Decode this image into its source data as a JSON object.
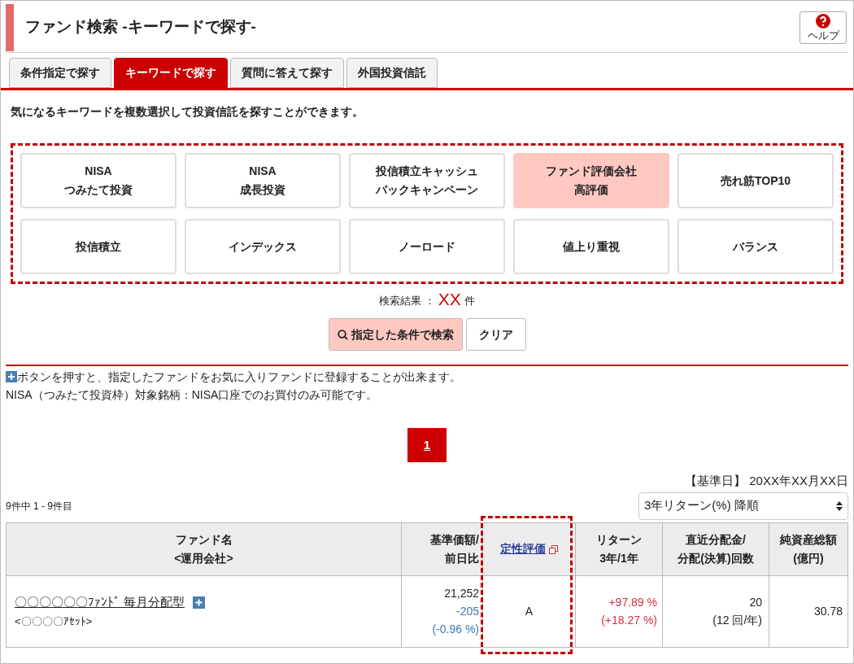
{
  "header": {
    "title": "ファンド検索 -キーワードで探す-",
    "help_label": "ヘルプ"
  },
  "tabs": [
    {
      "label": "条件指定で探す",
      "selected": false
    },
    {
      "label": "キーワードで探す",
      "selected": true
    },
    {
      "label": "質問に答えて探す",
      "selected": false
    },
    {
      "label": "外国投資信託",
      "selected": false
    }
  ],
  "description": "気になるキーワードを複数選択して投資信託を探すことができます。",
  "keywords": [
    {
      "lines": [
        "NISA",
        "つみたて投資"
      ],
      "selected": false
    },
    {
      "lines": [
        "NISA",
        "成長投資"
      ],
      "selected": false
    },
    {
      "lines": [
        "投信積立キャッシュ",
        "バックキャンペーン"
      ],
      "selected": false
    },
    {
      "lines": [
        "ファンド評価会社",
        "高評価"
      ],
      "selected": true
    },
    {
      "lines": [
        "売れ筋TOP10"
      ],
      "selected": false
    },
    {
      "lines": [
        "投信積立"
      ],
      "selected": false
    },
    {
      "lines": [
        "インデックス"
      ],
      "selected": false
    },
    {
      "lines": [
        "ノーロード"
      ],
      "selected": false
    },
    {
      "lines": [
        "値上り重視"
      ],
      "selected": false
    },
    {
      "lines": [
        "バランス"
      ],
      "selected": false
    }
  ],
  "result": {
    "label": "検索結果 ：",
    "count": "XX",
    "unit": "件"
  },
  "search_button": "指定した条件で検索",
  "clear_button": "クリア",
  "notes": [
    "ボタンを押すと、指定したファンドをお気に入りファンドに登録することが出来ます。",
    "NISA（つみたて投資枠）対象銘柄：NISA口座でのお買付のみ可能です。"
  ],
  "pages": [
    {
      "label": "1",
      "selected": true
    }
  ],
  "base_date": "【基準日】 20XX年XX月XX日",
  "range": "9件中 1 - 9件目",
  "sort": {
    "value": "3年リターン(%) 降順"
  },
  "table": {
    "columns": [
      {
        "lines": [
          "ファンド名",
          "<運用会社>"
        ]
      },
      {
        "lines": [
          "基準価額/",
          "前日比"
        ]
      },
      {
        "lines": [
          "定性評価"
        ],
        "link": true
      },
      {
        "lines": [
          "リターン",
          "3年/1年"
        ]
      },
      {
        "lines": [
          "直近分配金/",
          "分配(決算)回数"
        ]
      },
      {
        "lines": [
          "純資産総額",
          "(億円)"
        ]
      }
    ],
    "rows": [
      {
        "name": "〇〇〇〇〇〇ﾌｧﾝﾄﾞ 毎月分配型",
        "company": "<〇〇〇〇ｱｾｯﾄ>",
        "price": "21,252",
        "change": "-205",
        "change_pct": "(-0.96 %)",
        "rating": "A",
        "return_3y": "+97.89 %",
        "return_1y": "(+18.27 %)",
        "dividend": "20",
        "frequency": "(12 回/年)",
        "assets": "30.78"
      }
    ]
  }
}
